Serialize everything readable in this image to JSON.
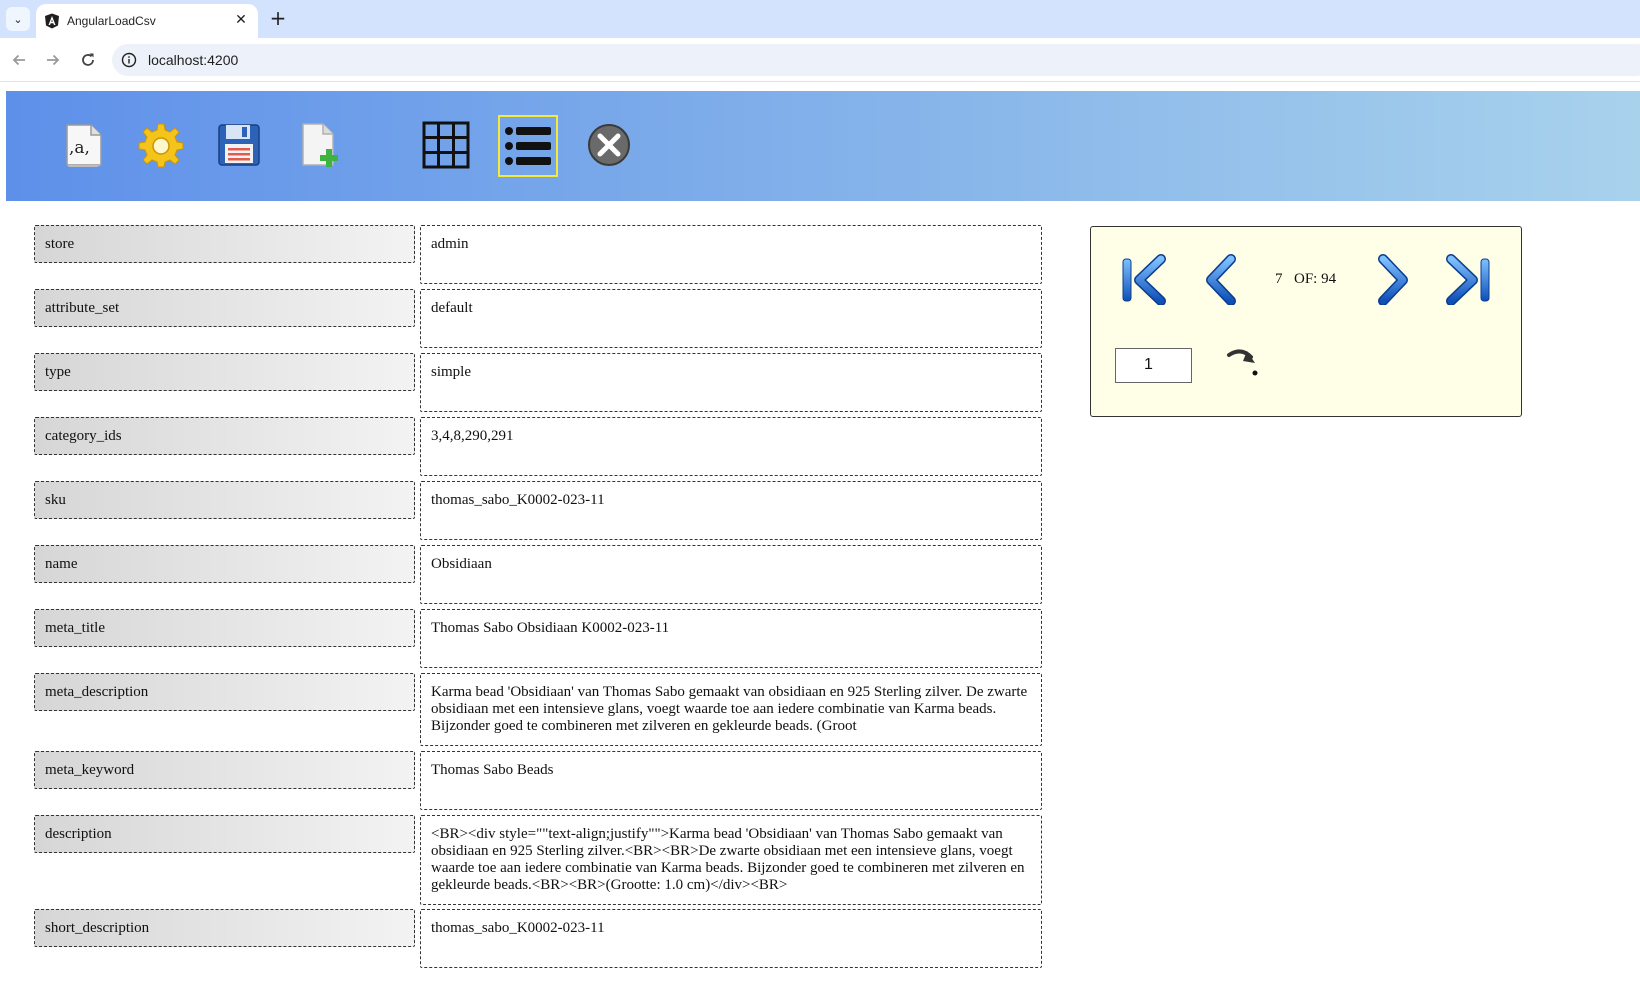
{
  "browser": {
    "tab_title": "AngularLoadCsv",
    "tab_close_glyph": "✕",
    "new_tab_glyph": "+",
    "tab_list_glyph": "⌄",
    "url": "localhost:4200"
  },
  "header_icons": [
    {
      "name": "csv-separator-icon"
    },
    {
      "name": "settings-gear-icon"
    },
    {
      "name": "save-floppy-icon"
    },
    {
      "name": "new-file-icon"
    },
    {
      "name": "grid-view-icon"
    },
    {
      "name": "list-view-icon",
      "selected": true
    },
    {
      "name": "close-circle-icon"
    }
  ],
  "header_glyph": ",a,",
  "fields": [
    {
      "label": "store",
      "value": "admin"
    },
    {
      "label": "attribute_set",
      "value": "default"
    },
    {
      "label": "type",
      "value": "simple"
    },
    {
      "label": "category_ids",
      "value": "3,4,8,290,291"
    },
    {
      "label": "sku",
      "value": "thomas_sabo_K0002-023-11"
    },
    {
      "label": "name",
      "value": "Obsidiaan"
    },
    {
      "label": "meta_title",
      "value": "Thomas Sabo Obsidiaan K0002-023-11"
    },
    {
      "label": "meta_description",
      "value": "Karma bead 'Obsidiaan' van Thomas Sabo gemaakt van obsidiaan en 925 Sterling zilver. De zwarte obsidiaan met een intensieve glans, voegt waarde toe aan iedere combinatie van Karma beads. Bijzonder goed te combineren met zilveren en gekleurde beads. (Groot"
    },
    {
      "label": "meta_keyword",
      "value": "Thomas Sabo Beads"
    },
    {
      "label": "description",
      "value": "<BR><div style=\"\"text-align;justify\"\">Karma bead 'Obsidiaan' van Thomas Sabo gemaakt van obsidiaan en 925 Sterling zilver.<BR><BR>De zwarte obsidiaan met een intensieve glans, voegt waarde toe aan iedere combinatie van Karma beads. Bijzonder goed te combineren met zilveren en gekleurde beads.<BR><BR>(Grootte: 1.0 cm)</div><BR>"
    },
    {
      "label": "short_description",
      "value": "thomas_sabo_K0002-023-11"
    }
  ],
  "navigator": {
    "current_record": "7",
    "of_label": "OF: 94",
    "page_input_value": "1"
  },
  "colors": {
    "header_start": "#5e90ea",
    "header_end": "#a8d2ec",
    "selected_border": "#f6e93a",
    "nav_arrow": "#1f6fd6",
    "navigator_bg": "#ffffe8"
  }
}
